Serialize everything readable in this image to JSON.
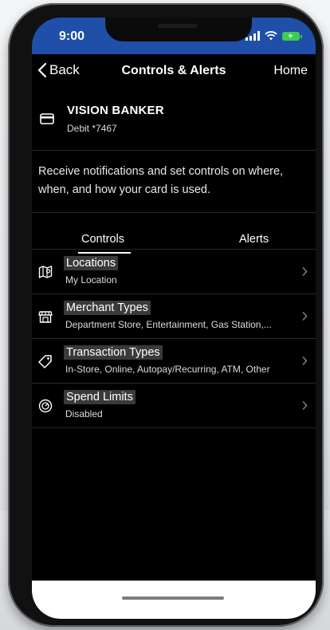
{
  "status_bar": {
    "time": "9:00",
    "signal_icon": "signal-bars-icon",
    "wifi_icon": "wifi-icon",
    "battery_icon": "battery-charging-icon",
    "color": "#1f4fa8"
  },
  "nav": {
    "back_label": "Back",
    "title": "Controls & Alerts",
    "home_label": "Home"
  },
  "card": {
    "icon": "credit-card-icon",
    "name": "VISION BANKER",
    "number": "Debit *7467"
  },
  "description": "Receive notifications and set controls on where, when, and how your card is used.",
  "tabs": [
    {
      "label": "Controls",
      "selected": true
    },
    {
      "label": "Alerts",
      "selected": false
    }
  ],
  "controls": [
    {
      "icon": "map-icon",
      "title": "Locations",
      "subtitle": "My Location"
    },
    {
      "icon": "storefront-icon",
      "title": "Merchant Types",
      "subtitle": "Department Store, Entertainment, Gas Station,..."
    },
    {
      "icon": "tag-icon",
      "title": "Transaction Types",
      "subtitle": "In-Store, Online, Autopay/Recurring, ATM, Other"
    },
    {
      "icon": "gauge-icon",
      "title": "Spend Limits",
      "subtitle": "Disabled"
    }
  ]
}
